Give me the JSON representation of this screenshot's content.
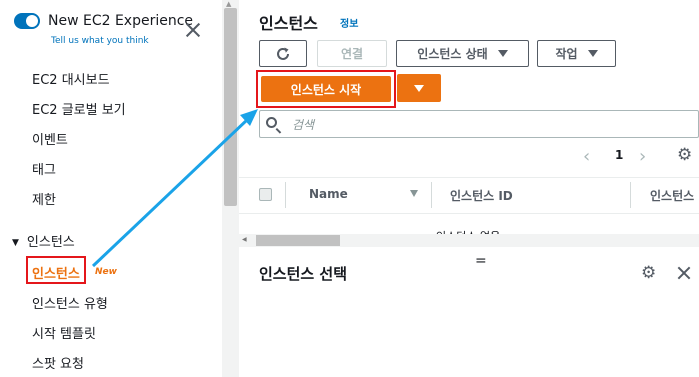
{
  "sidebar": {
    "experience_title": "New EC2 Experience",
    "experience_link": "Tell us what you think",
    "items": [
      "EC2 대시보드",
      "EC2 글로벌 보기",
      "이벤트",
      "태그",
      "제한"
    ],
    "section_title": "인스턴스",
    "active_item": "인스턴스",
    "active_badge": "New",
    "sub_items": [
      "인스턴스 유형",
      "시작 템플릿",
      "스팟 요청"
    ]
  },
  "main": {
    "title": "인스턴스",
    "info_link": "정보",
    "toolbar": {
      "connect": "연결",
      "instance_state": "인스턴스 상태",
      "actions": "작업",
      "launch": "인스턴스 시작"
    },
    "search_placeholder": "검색",
    "pagination": {
      "current_page": "1"
    },
    "table": {
      "columns": [
        "Name",
        "인스턴스 ID",
        "인스턴스"
      ],
      "partial_row_text": "인스턴스 없음"
    },
    "divider_handle": "=",
    "bottom_panel_title": "인스턴스 선택"
  },
  "colors": {
    "accent_orange": "#ec7211",
    "link_blue": "#0073bb",
    "highlight_red": "#e4161b",
    "annotation_arrow": "#1aa3e8"
  },
  "icons": {
    "refresh": "refresh-icon",
    "search": "search-icon",
    "settings": "gear-icon",
    "close": "close-icon"
  }
}
